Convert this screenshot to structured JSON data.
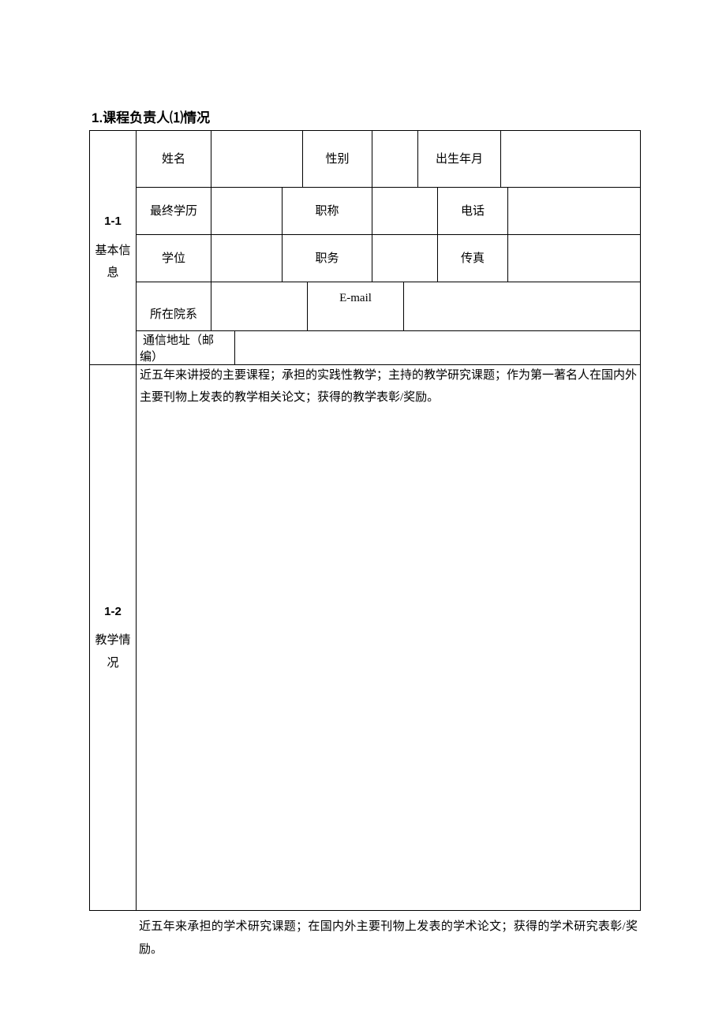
{
  "heading": "1.课程负责人⑴情况",
  "section1": {
    "side_num": "1-1",
    "side_text": "基本信息",
    "row1": {
      "name_label": "姓名",
      "name_value": "",
      "gender_label": "性别",
      "gender_value": "",
      "birth_label": "出生年月",
      "birth_value": ""
    },
    "row2": {
      "edu_label": "最终学历",
      "edu_value": "",
      "title_label": "职称",
      "title_value": "",
      "phone_label": "电话",
      "phone_value": ""
    },
    "row3": {
      "degree_label": "学位",
      "degree_value": "",
      "duty_label": "职务",
      "duty_value": "",
      "fax_label": "传真",
      "fax_value": ""
    },
    "row4": {
      "dept_label": "所在院系",
      "dept_value": "",
      "email_label": "E-mail",
      "email_value": ""
    },
    "row5": {
      "addr_label": "通信地址（邮编）",
      "addr_value": ""
    }
  },
  "section2": {
    "side_num": "1-2",
    "side_text": "教学情况",
    "content": "近五年来讲授的主要课程；承担的实践性教学；主持的教学研究课题；作为第一著名人在国内外主要刊物上发表的教学相关论文；获得的教学表彰/奖励。"
  },
  "section3": {
    "content": "近五年来承担的学术研究课题；在国内外主要刊物上发表的学术论文；获得的学术研究表彰/奖励。"
  }
}
